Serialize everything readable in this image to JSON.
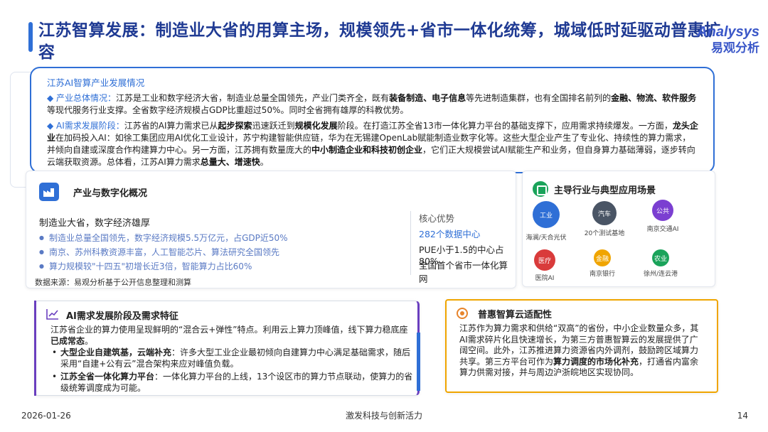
{
  "title": "江苏智算发展：制造业大省的用算主场，规模领先+省市一体化统筹，城域低时延驱动普惠扩容",
  "logo": {
    "en": "Analysys",
    "cn": "易观分析"
  },
  "overview": {
    "heading": "江苏AI智算产业发展情况",
    "p1": {
      "key": "◆ 产业总体情况：",
      "t1": "江苏是工业和数字经济大省，制造业总量全国领先，产业门类齐全，既有",
      "b1": "装备制造、电子信息",
      "t2": "等先进制造集群，也有全国排名前列的",
      "b2": "金融、物流、软件服务",
      "t3": "等现代服务行业支撑。全省数字经济规模占GDP比重超过50%。同时全省拥有雄厚的科教优势。"
    },
    "p2": {
      "key": "◆ AI需求发展阶段：",
      "t1": "江苏省的AI算力需求已从",
      "b1": "起步探索",
      "t2": "迅速跃迁到",
      "b2": "规模化发展",
      "t3": "阶段。在打造江苏全省13市一体化算力平台的基础支撑下，应用需求持续爆发。一方面，",
      "b3": "龙头企业",
      "t4": "在加码投入AI：如徐工集团应用AI优化工业设计，苏宁构建智能供应链，华为在无锡建OpenLab赋能制造业数字化等。这些大型企业产生了专业化、持续性的算力需求，并倾向自建或深度合作构建算力中心。另一方面，江苏拥有数量庞大的",
      "b4": "中小制造企业和科技初创企业",
      "t5": "，它们正大规模尝试AI赋能生产和业务，但自身算力基础薄弱，逐步转向云端获取资源。总体看，江苏AI算力需求",
      "b5": "总量大、增速快",
      "t6": "。"
    }
  },
  "industry": {
    "heading": "产业与数字化概况",
    "subtitle": "制造业大省，数字经济雄厚",
    "items": [
      "制造业总量全国领先，数字经济规模5.5万亿元，占GDP近50%",
      "南京、苏州科教资源丰富，人工智能芯片、算法研究全国领先",
      "算力规模较\"十四五\"初增长近3倍，智能算力占比60%"
    ],
    "advantage_heading": "核心优势",
    "advantages": [
      "282个数据中心",
      "PUE小于1.5的中心占80%",
      "全国首个省市一体化算网"
    ],
    "source": "数据来源：易观分析基于公开信息整理和测算"
  },
  "apps": {
    "heading": "主导行业与典型应用场景",
    "items": [
      {
        "name": "工业",
        "label": "海澜/天合光伏",
        "color": "#2f6fd6"
      },
      {
        "name": "汽车",
        "label": "20个测试基地",
        "color": "#4a5565"
      },
      {
        "name": "公共",
        "label": "南京交通AI",
        "color": "#7b3fd1"
      },
      {
        "name": "医疗",
        "label": "医院AI",
        "color": "#d93b3b"
      },
      {
        "name": "金融",
        "label": "南京银行",
        "color": "#f0a500"
      },
      {
        "name": "农业",
        "label": "徐州/连云港",
        "color": "#1aa35a"
      }
    ]
  },
  "ai_demand": {
    "heading": "AI需求发展阶段及需求特征",
    "intro_t1": "江苏省企业的算力使用呈现鲜明的“混合云+弹性”特点。利用云上算力顶峰值，线下算力稳底座",
    "intro_b1": "已成常态",
    "intro_t2": "。",
    "b1_bold": "大型企业自建筑基，云端补充",
    "b1_text": "：许多大型工业企业最初倾向自建算力中心满足基础需求，随后采用“自建+公有云”混合架构来应对峰值负载。",
    "b2_bold": "江苏全省一体化算力平台",
    "b2_text": "：一体化算力平台的上线，13个设区市的算力节点联动，使算力的省级统筹调度成为可能。"
  },
  "cloud": {
    "heading": "普惠智算云适配性",
    "t1": "江苏作为算力需求和供给“双高”的省份，中小企业数量众多，其AI需求碎片化且快速增长，为第三方普惠智算云的发展提供了广阔空间。此外，江苏推进算力资源省内外调剂，鼓励跨区域算力共享。第三方平台可作为",
    "b1": "算力调度的市场化补充",
    "t2": "，打通省内富余算力供需对接，并与周边沪浙皖地区实现协同。"
  },
  "footer": {
    "date": "2026-01-26",
    "slogan": "激发科技与创新活力",
    "page": "14"
  },
  "colors": {
    "primary": "#2f6fd6",
    "purple": "#6a3fbf",
    "orange": "#f0a500"
  }
}
